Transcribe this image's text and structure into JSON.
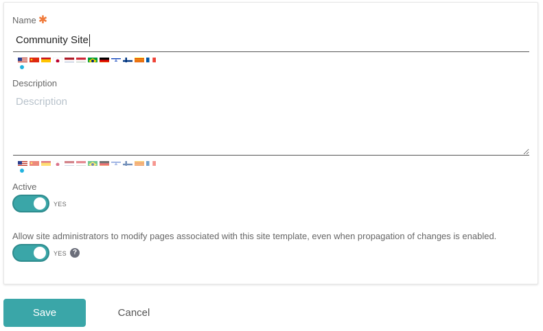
{
  "form": {
    "name_label": "Name",
    "required_mark": "✱",
    "name_value": "Community Site",
    "description_label": "Description",
    "description_placeholder": "Description",
    "active_label": "Active",
    "active_state": "YES",
    "allow_modify_label": "Allow site administrators to modify pages associated with this site template, even when propagation of changes is enabled.",
    "allow_modify_state": "YES",
    "help_glyph": "?"
  },
  "languages": [
    "en-US",
    "zh-CN",
    "es-ES",
    "ja-JP",
    "nl-NL",
    "hu-HU",
    "pt-BR",
    "de-DE",
    "iw-IL",
    "fi-FI",
    "ca-ES",
    "fr-FR"
  ],
  "colors": {
    "accent": "#3aa6a8",
    "required": "#f07a3a",
    "active_dot": "#21b3e0"
  },
  "actions": {
    "save_label": "Save",
    "cancel_label": "Cancel"
  }
}
